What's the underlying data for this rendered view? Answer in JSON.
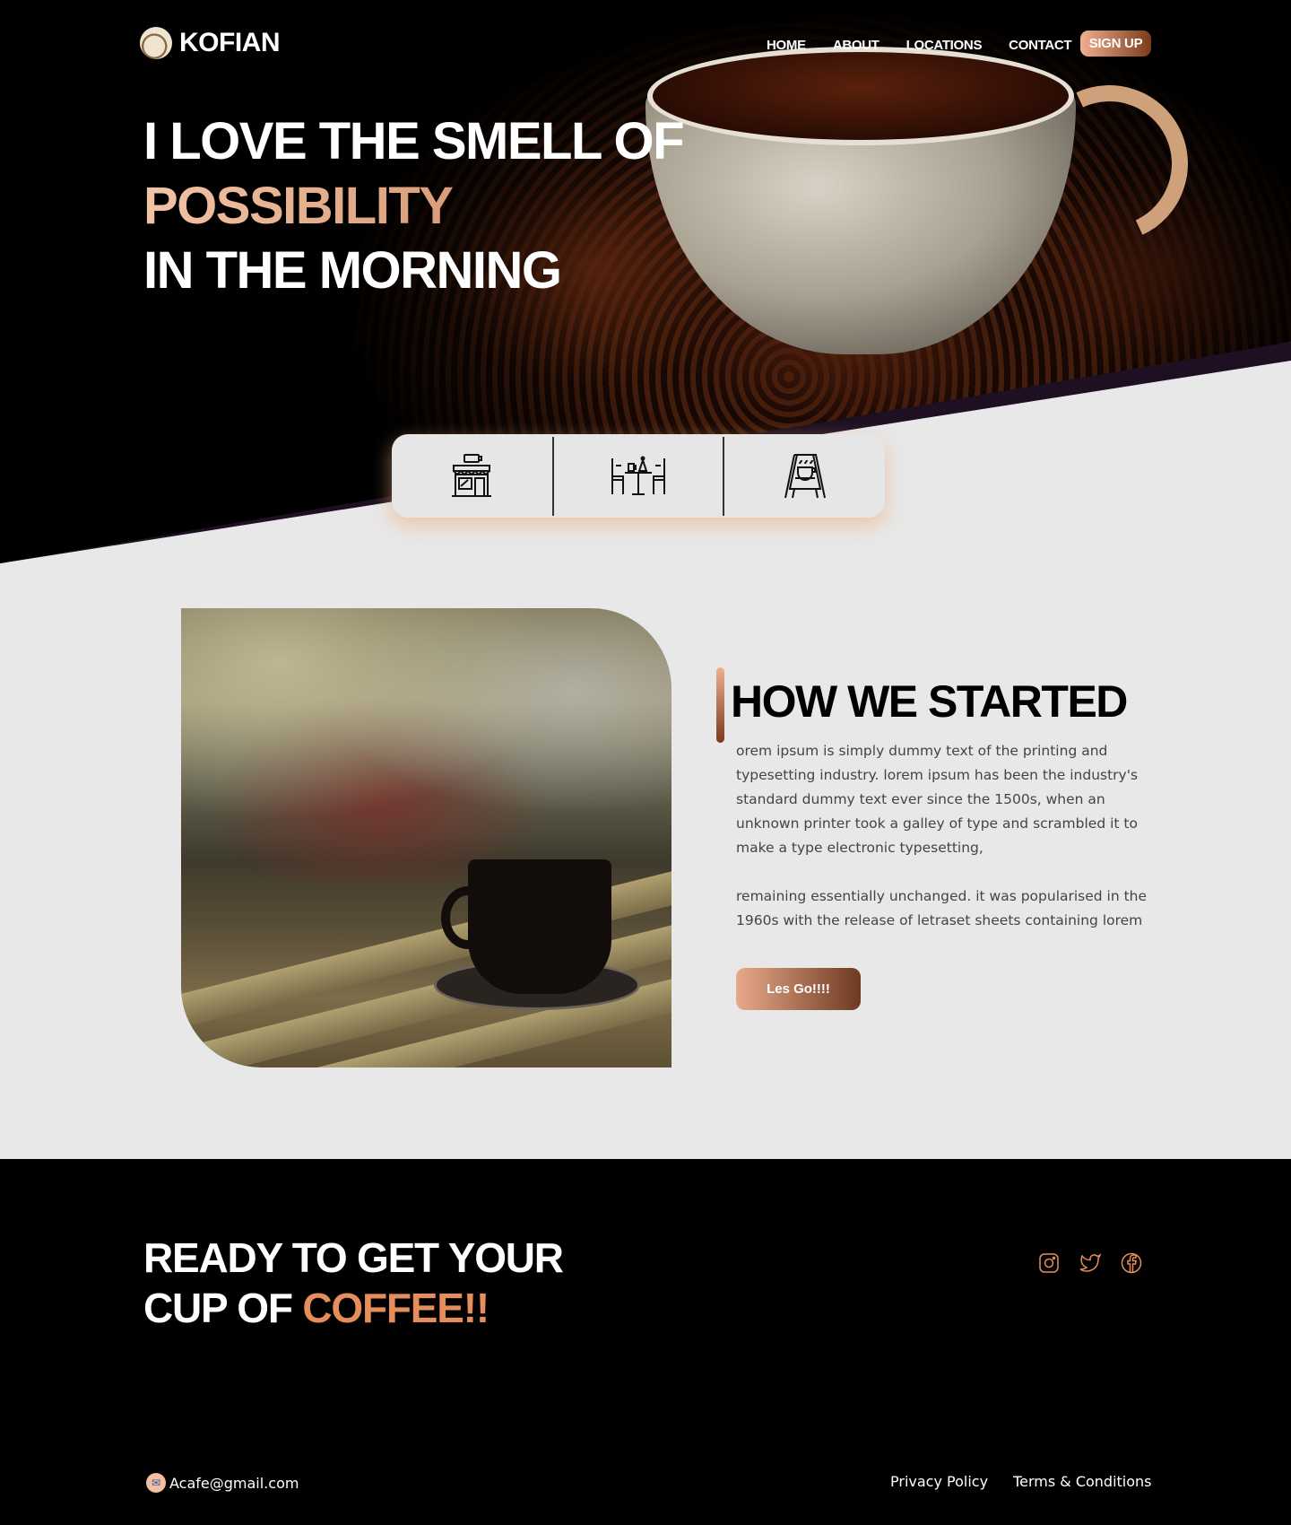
{
  "brand": {
    "name": "KOFIAN",
    "icon": "coffee-cup-icon"
  },
  "nav": {
    "items": [
      "HOME",
      "ABOUT",
      "LOCATIONS",
      "CONTACT"
    ],
    "signup_label": "SIGN UP"
  },
  "hero": {
    "line1": "I LOVE THE SMELL OF",
    "line2": "POSSIBILITY",
    "line3": "IN THE MORNING"
  },
  "features": {
    "icons": [
      "coffee-shop-icon",
      "cafe-table-icon",
      "menu-board-icon"
    ]
  },
  "about": {
    "title": "HOW WE STARTED",
    "paragraph1": "orem ipsum is simply dummy text of the printing and typesetting industry. lorem ipsum has been the industry's standard dummy text ever since the 1500s, when an unknown printer took a galley of type and scrambled it to make a type  electronic typesetting,",
    "paragraph2": " remaining essentially unchanged. it was popularised in the 1960s with the release of letraset sheets containing lorem",
    "cta_label": "Les Go!!!!"
  },
  "footer": {
    "ready_line1": "READY TO GET YOUR",
    "ready_line2_prefix": "CUP OF ",
    "ready_line2_accent": "COFFEE!!",
    "socials": [
      "instagram-icon",
      "twitter-icon",
      "facebook-icon"
    ],
    "email": "Acafe@gmail.com",
    "links": [
      "Privacy Policy",
      "Terms & Conditions"
    ]
  },
  "colors": {
    "accent": "#e58e5c",
    "gradient_light": "#f0b08f",
    "gradient_dark": "#7a3b1b",
    "hero_bg": "#000000",
    "page_bg": "#e8e8e8"
  }
}
